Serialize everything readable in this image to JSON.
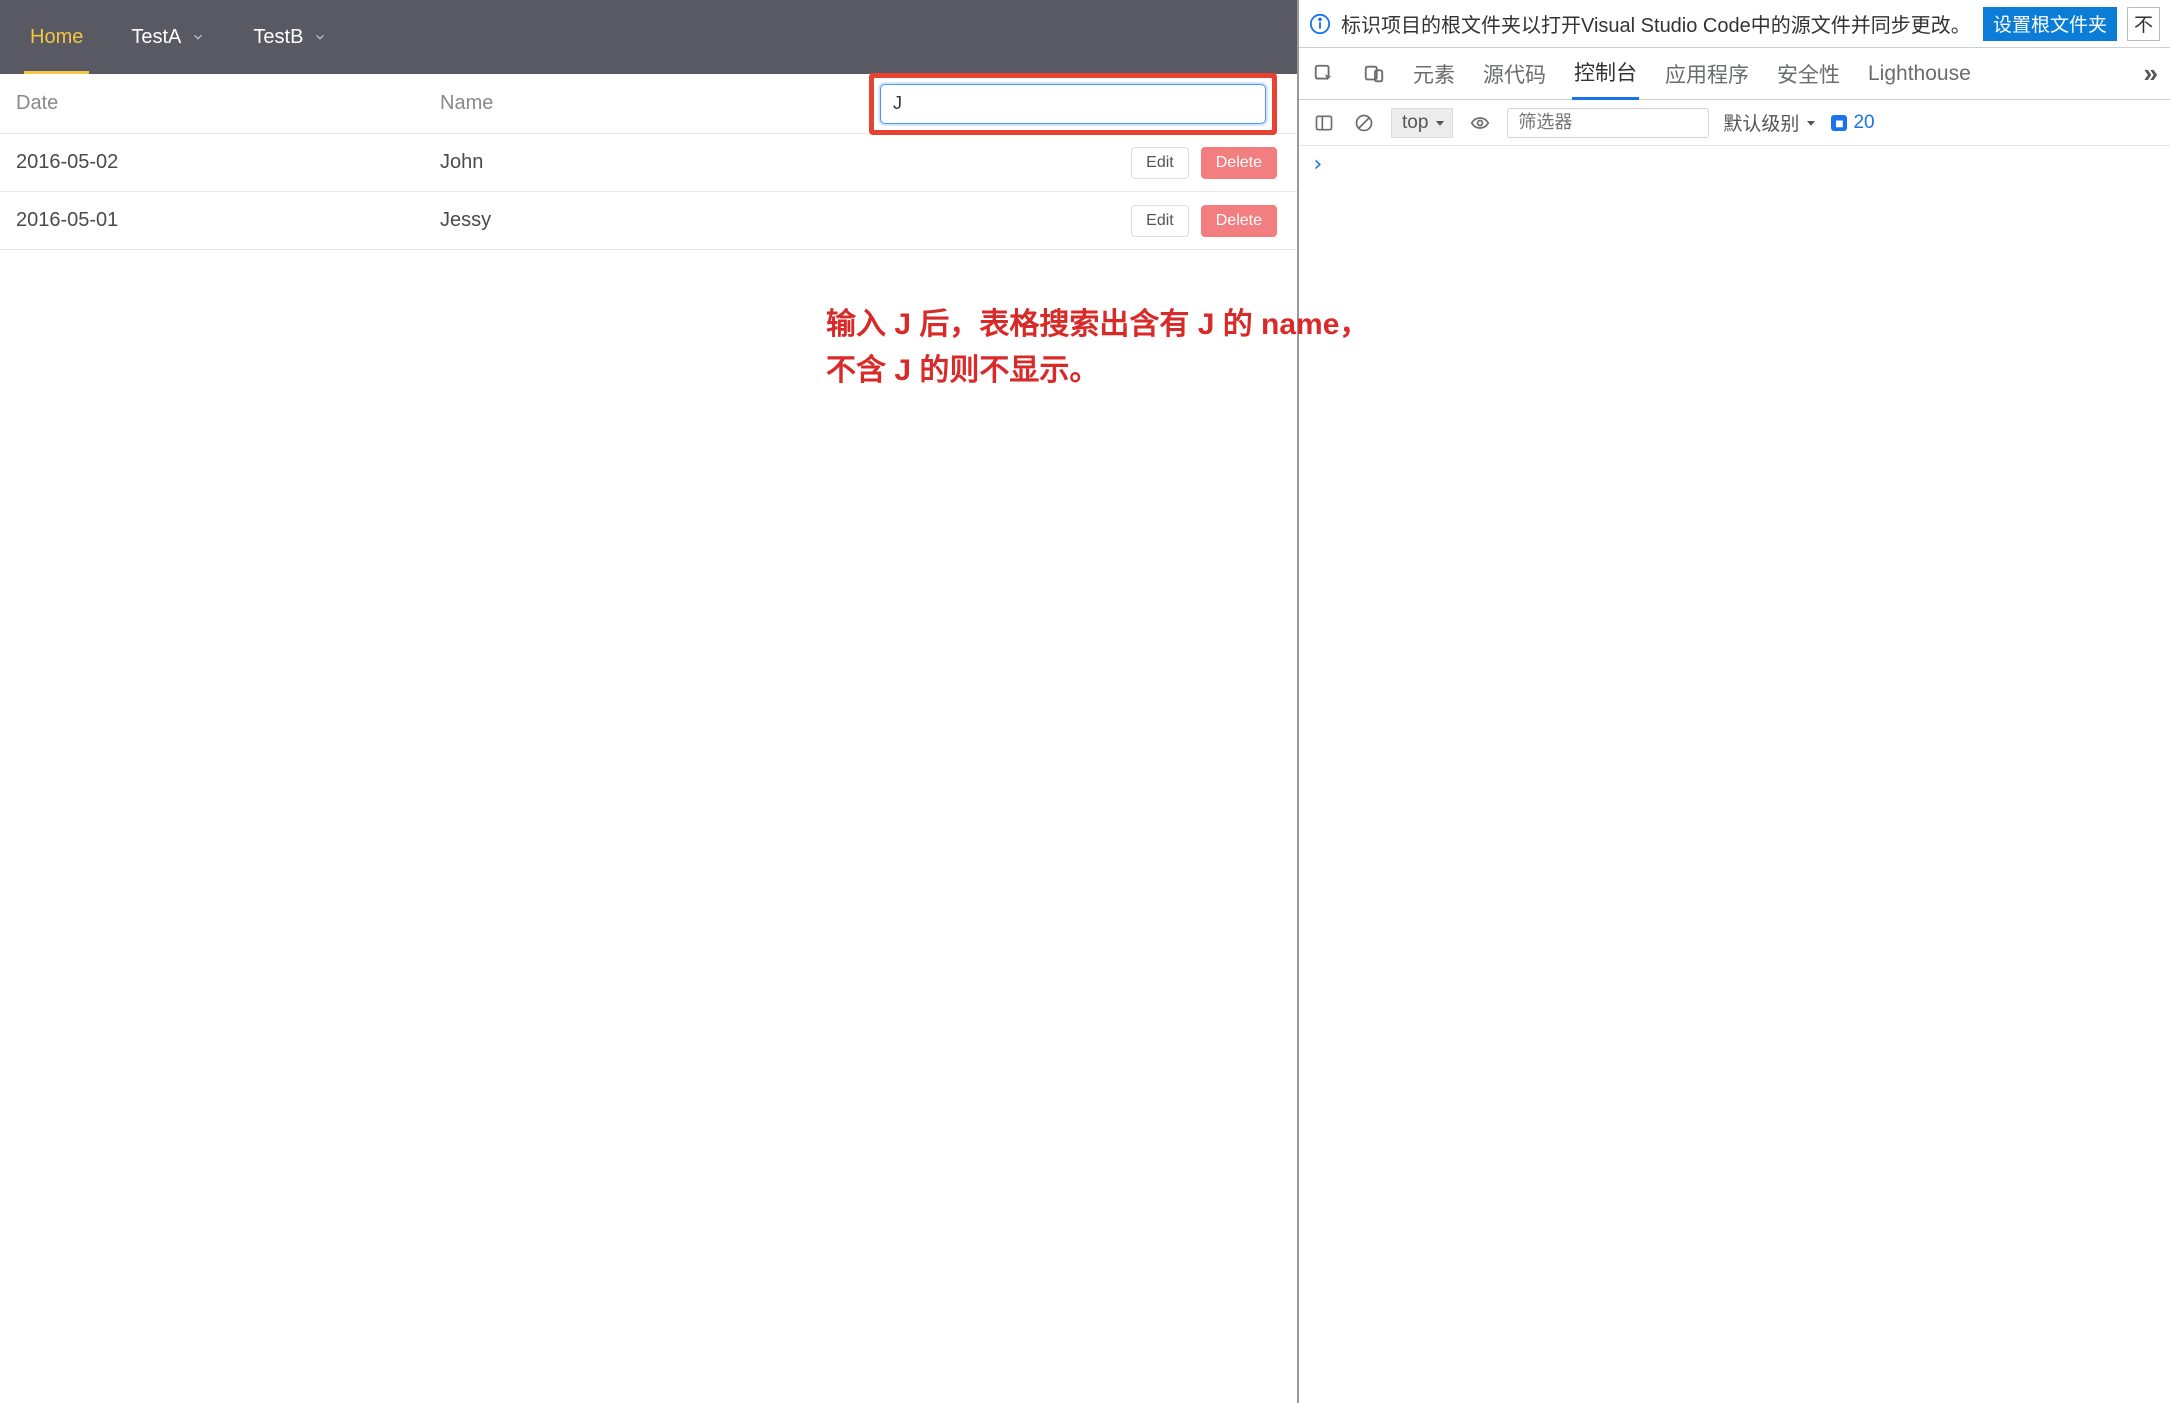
{
  "tabs": [
    {
      "label": "Home",
      "active": true,
      "has_caret": false
    },
    {
      "label": "TestA",
      "active": false,
      "has_caret": true
    },
    {
      "label": "TestB",
      "active": false,
      "has_caret": true
    }
  ],
  "table": {
    "columns": {
      "date": "Date",
      "name": "Name"
    },
    "search_value": "J",
    "rows": [
      {
        "date": "2016-05-02",
        "name": "John",
        "edit": "Edit",
        "delete": "Delete"
      },
      {
        "date": "2016-05-01",
        "name": "Jessy",
        "edit": "Edit",
        "delete": "Delete"
      }
    ]
  },
  "annotation": "输入 J 后，表格搜索出含有 J 的 name，\n不含 J 的则不显示。",
  "devtools": {
    "notice": {
      "text": "标识项目的根文件夹以打开Visual Studio Code中的源文件并同步更改。",
      "primary_btn": "设置根文件夹",
      "secondary_btn": "不"
    },
    "tabs": {
      "elements": "元素",
      "sources": "源代码",
      "console": "控制台",
      "application": "应用程序",
      "security": "安全性",
      "lighthouse": "Lighthouse"
    },
    "toolbar": {
      "scope": "top",
      "filter_placeholder": "筛选器",
      "loglevel": "默认级别",
      "issues_count": "20"
    }
  }
}
